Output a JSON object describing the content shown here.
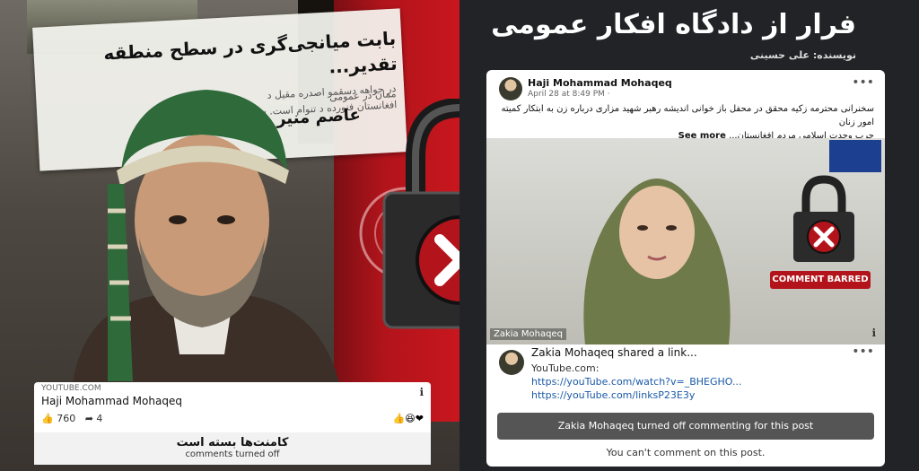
{
  "left": {
    "headline": "بابت میانجی‌گری در سطح منطقه تقدیر...",
    "body_line1": "در جواهه دسقمو اصدره مقیل د",
    "body_line2": "افغانستان فنورده د تنوام است. سا",
    "body_line3": "ممان در عمومی",
    "author": "عاصم منیر",
    "card": {
      "source": "YOUTUBE.COM",
      "name": "Haji Mohammad Mohaqeq",
      "likes": "760",
      "shares": "4",
      "closed_fa": "کامنت‌ها بسته است",
      "closed_en": "comments turned off"
    }
  },
  "right": {
    "title": "فرار از دادگاه افکار عمومی",
    "byline": "نویسنده: علی حسینی",
    "post": {
      "author": "Haji Mohammad Mohaqeq",
      "time": "April 28 at 8:49 PM ·",
      "text_line1": "سخنرانی محترمه زکیه محقق در محفل باز خوانی اندیشه رهبر شهید مزاری درباره زن به ابتکار کمیته امور زنان",
      "text_line2": "حرب وحدت اسلامی مردم افغانستان...",
      "see_more": "See more",
      "video_label": "Zakia Mohaqeq",
      "badge": "COMMENT BARRED",
      "sharer": "Zakia Mohaqeq shared a link...",
      "site": "YouTube.com:",
      "link1": "https://youTube.com/watch?v=_BHEGHO...",
      "link2": "https://youTube.com/linksP23E3y",
      "banner": "Zakia Mohaqeq turned off commenting for this post",
      "cant": "You can't comment on this post."
    }
  },
  "colors": {
    "accent_red": "#c8161e",
    "fb_blue": "#1a5aa8"
  }
}
